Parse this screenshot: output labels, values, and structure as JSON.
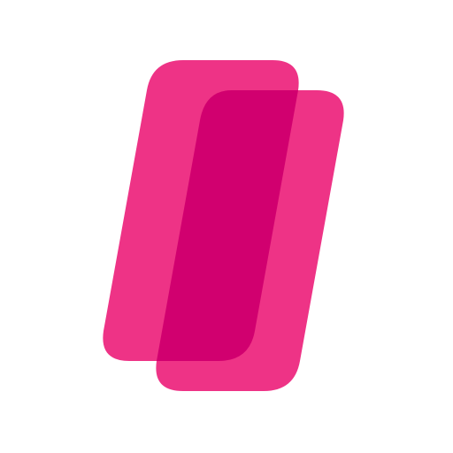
{
  "logo": {
    "icon": "overlapping-slanted-rounded-rectangles-icon",
    "colors": {
      "background": "#ffffff",
      "shape": "#ee3386",
      "overlap": "#d1006f"
    }
  }
}
